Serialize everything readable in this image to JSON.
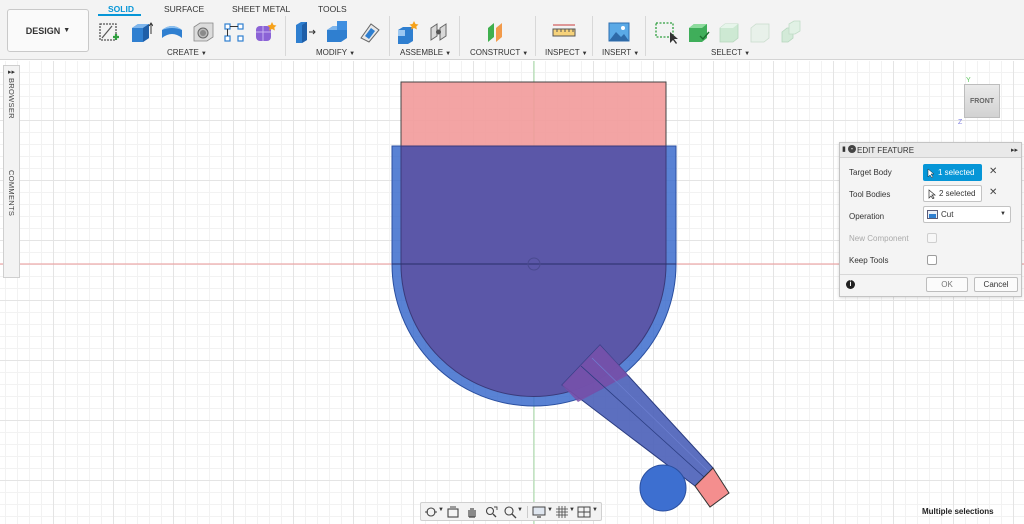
{
  "workspace": {
    "label": "DESIGN"
  },
  "tabs": [
    {
      "label": "SOLID",
      "active": true
    },
    {
      "label": "SURFACE",
      "active": false
    },
    {
      "label": "SHEET METAL",
      "active": false
    },
    {
      "label": "TOOLS",
      "active": false
    }
  ],
  "groups": {
    "create": "CREATE",
    "modify": "MODIFY",
    "assemble": "ASSEMBLE",
    "construct": "CONSTRUCT",
    "inspect": "INSPECT",
    "insert": "INSERT",
    "select": "SELECT"
  },
  "side_panel": {
    "browser": "BROWSER",
    "comments": "COMMENTS"
  },
  "viewcube": {
    "face": "FRONT"
  },
  "dialog": {
    "title": "EDIT FEATURE",
    "target_body_label": "Target Body",
    "target_body_value": "1 selected",
    "tool_bodies_label": "Tool Bodies",
    "tool_bodies_value": "2 selected",
    "operation_label": "Operation",
    "operation_value": "Cut",
    "new_component_label": "New Component",
    "keep_tools_label": "Keep Tools",
    "ok_label": "OK",
    "cancel_label": "Cancel"
  },
  "status": {
    "text": "Multiple selections"
  },
  "colors": {
    "accent": "#0696d7",
    "target_body": "#3b5fbf",
    "tool_body": "#f08a8a",
    "x_axis": "#e98a8a",
    "y_axis": "#8fd08f"
  },
  "icons": [
    "sketch-icon",
    "extrude-icon",
    "revolve-icon",
    "hole-icon",
    "rectangular-pattern-icon",
    "form-icon",
    "press-pull-icon",
    "fillet-icon",
    "shell-icon",
    "new-component-icon",
    "joint-icon",
    "offset-plane-icon",
    "measure-icon",
    "insert-image-icon",
    "window-select-icon",
    "orbit-icon",
    "look-at-icon",
    "pan-icon",
    "zoom-icon",
    "fit-icon",
    "display-settings-icon",
    "grid-icon",
    "viewports-icon"
  ]
}
